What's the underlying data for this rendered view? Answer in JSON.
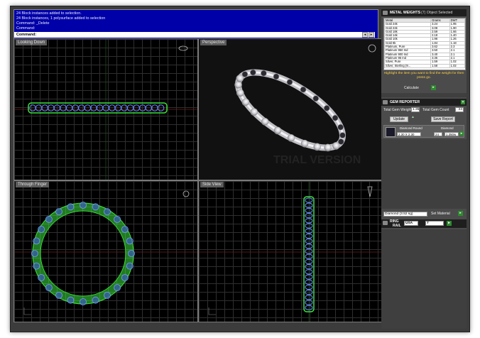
{
  "command": {
    "lines": [
      "24 Block instances added to selection.",
      "24 Block instances, 1 polysurface added to selection",
      "Command: _Delete",
      "Command:"
    ],
    "prompt": "Command:"
  },
  "viewports": {
    "top_left": "Looking Down",
    "top_right": "Perspective",
    "bottom_left": "Through Finger",
    "bottom_right": "Side View",
    "watermark": "TRIAL VERSION"
  },
  "metal_weights": {
    "title": "METAL WEIGHTS",
    "subtitle": "(7) Object Selected",
    "columns": [
      "Metal",
      "Grams",
      "DWT"
    ],
    "rows": [
      [
        "Gold 24k",
        "3.24",
        "1.95"
      ],
      [
        "Gold 22k",
        "3.08",
        "1.90"
      ],
      [
        "Gold 18k",
        "2.59",
        "1.66"
      ],
      [
        "Gold 14k",
        "2.18",
        "1.40"
      ],
      [
        "Gold 10k",
        "1.96",
        "1.26"
      ],
      [
        "Gold 9k",
        "1.84",
        "1.18"
      ],
      [
        "Platinum, Pure",
        "3.62",
        "2.3"
      ],
      [
        "Platinum 950 Ind",
        "3.50",
        "2.1"
      ],
      [
        "Platinum 900 Ind",
        "3.40",
        "2.1"
      ],
      [
        "Platinum 95 Ind",
        "3.35",
        "2.1"
      ],
      [
        "Silver, Pure",
        "1.59",
        "1.02"
      ],
      [
        "Silver, Sterling (9...",
        "1.58",
        "1.02"
      ]
    ],
    "hint": "Highlight the item you want to find the weight for then press go.",
    "calculate_label": "Calculate"
  },
  "gem_reporter": {
    "title": "GEM REPORTER",
    "total_weight_label": "Total Gem Weight",
    "total_weight_value": "1.35",
    "total_count_label": "Total Gem Count",
    "total_count_value": "24",
    "update_label": "Update",
    "save_report_label": "Save Report",
    "gem": {
      "name": "Diamond Round",
      "type": "Diamond",
      "size": "2.30 X 2.30",
      "count": "24",
      "weight": "1.350w"
    }
  },
  "material": {
    "select_value": "Diamond   (3.52 sg)",
    "set_label": "Set Material"
  },
  "ring_rail": {
    "label1": "RING",
    "label2": "RAIL",
    "standard": "USA",
    "size": "7"
  },
  "colors": {
    "command_bg": "#0000a8",
    "ring_green": "#3ce03c",
    "gem_blue": "#6a8cff",
    "accent_green": "#2e8b2e",
    "hint_yellow": "#ffd24a"
  }
}
